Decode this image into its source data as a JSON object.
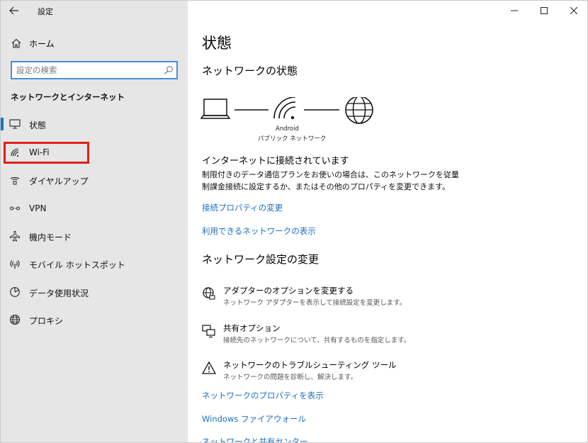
{
  "window": {
    "title": "設定"
  },
  "sidebar": {
    "home_label": "ホーム",
    "search_placeholder": "設定の検索",
    "section_title": "ネットワークとインターネット",
    "items": [
      {
        "label": "状態",
        "icon": "network-status-icon",
        "selected": true
      },
      {
        "label": "Wi-Fi",
        "icon": "wifi-icon"
      },
      {
        "label": "ダイヤルアップ",
        "icon": "dialup-icon"
      },
      {
        "label": "VPN",
        "icon": "vpn-icon"
      },
      {
        "label": "機内モード",
        "icon": "airplane-icon"
      },
      {
        "label": "モバイル ホットスポット",
        "icon": "hotspot-icon"
      },
      {
        "label": "データ使用状況",
        "icon": "data-usage-icon"
      },
      {
        "label": "プロキシ",
        "icon": "globe-icon"
      }
    ]
  },
  "main": {
    "page_title": "状態",
    "network_status_title": "ネットワークの状態",
    "diagram": {
      "network_name": "Android",
      "network_type": "パブリック ネットワーク"
    },
    "connection_status": "インターネットに接続されています",
    "description_line1": "制限付きのデータ通信プランをお使いの場合は、このネットワークを従量",
    "description_line2": "制課金接続に設定するか、またはその他のプロパティを変更できます。",
    "link_change_properties": "接続プロパティの変更",
    "link_show_networks": "利用できるネットワークの表示",
    "change_settings_title": "ネットワーク設定の変更",
    "options": [
      {
        "title": "アダプターのオプションを変更する",
        "desc": "ネットワーク アダプターを表示して接続設定を変更します。"
      },
      {
        "title": "共有オプション",
        "desc": "接続先のネットワークについて、共有するものを指定します。"
      },
      {
        "title": "ネットワークのトラブルシューティング ツール",
        "desc": "ネットワークの問題を診断し、解決します。"
      }
    ],
    "link_network_properties": "ネットワークのプロパティを表示",
    "link_firewall": "Windows ファイアウォール",
    "link_sharing_center": "ネットワークと共有センター"
  },
  "colors": {
    "accent": "#1a73c9",
    "link": "#1b6fbf",
    "highlight": "#e0201a",
    "sidebar_bg": "#e6e6e6"
  }
}
